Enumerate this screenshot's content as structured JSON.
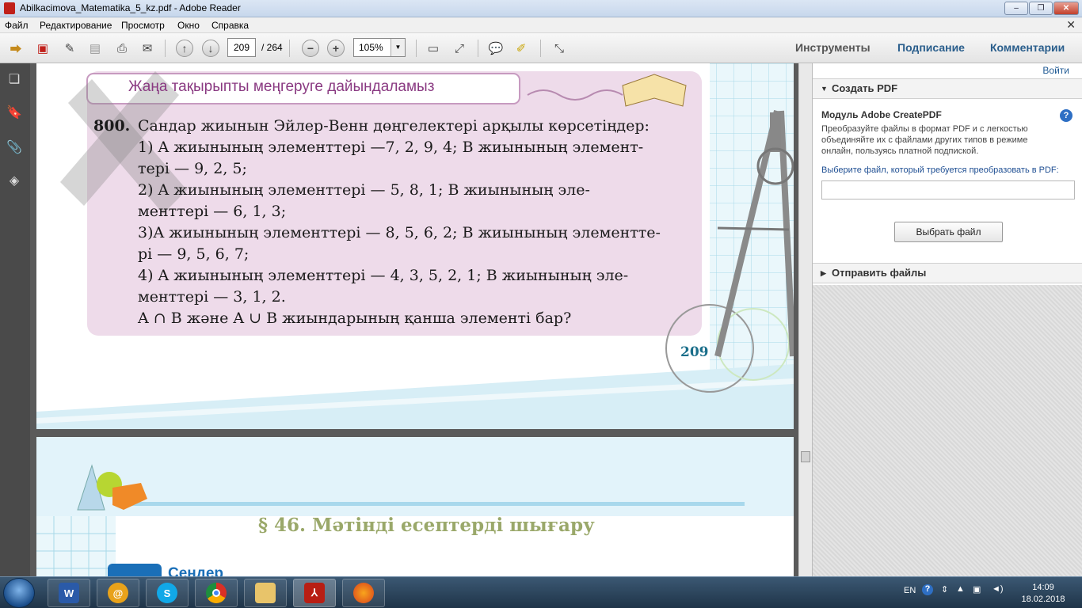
{
  "window": {
    "title": "Abilkacimova_Matematika_5_kz.pdf - Adobe Reader"
  },
  "menu": [
    "Файл",
    "Редактирование",
    "Просмотр",
    "Окно",
    "Справка"
  ],
  "toolbar": {
    "page_current": "209",
    "page_total": "/ 264",
    "zoom": "105%"
  },
  "right_links": [
    "Инструменты",
    "Подписание",
    "Комментарии"
  ],
  "panel": {
    "login": "Войти",
    "create_pdf": "Создать PDF",
    "module_title": "Модуль Adobe CreatePDF",
    "module_desc": "Преобразуйте файлы в формат PDF и с легкостью объединяйте их с файлами других типов в режиме онлайн, пользуясь платной подпиской.",
    "select_prompt": "Выберите файл, который требуется преобразовать в PDF:",
    "select_button": "Выбрать файл",
    "send_files": "Отправить файлы"
  },
  "page": {
    "banner": "Жаңа тақырыпты меңгеруге дайындаламыз",
    "problem_number": "800.",
    "lines": [
      "Сандар жиынын Эйлер-Венн дөңгелектері арқылы көрсетіңдер:",
      "1) A жиынының элементтері —7, 2, 9, 4; B жиынының элемент-",
      "тері — 9, 2, 5;",
      "2) A жиынының элементтері — 5, 8, 1; B жиынының эле-",
      "менттері — 6, 1, 3;",
      "3)A жиынының элементтері — 8, 5, 6, 2; B жиынының элементте-",
      "рі — 9, 5, 6, 7;",
      "4) A жиынының элементтері — 4, 3, 5, 2, 1; B жиынының эле-",
      "менттері — 3, 1, 2.",
      "A ∩ B және A ∪ B жиындарының қанша элементі бар?"
    ],
    "page_number": "209",
    "section_title": "§ 46. Мәтінді есептерді шығару",
    "partial_text": "Сендер"
  },
  "taskbar": {
    "lang": "EN",
    "time": "14:09",
    "date": "18.02.2018"
  }
}
